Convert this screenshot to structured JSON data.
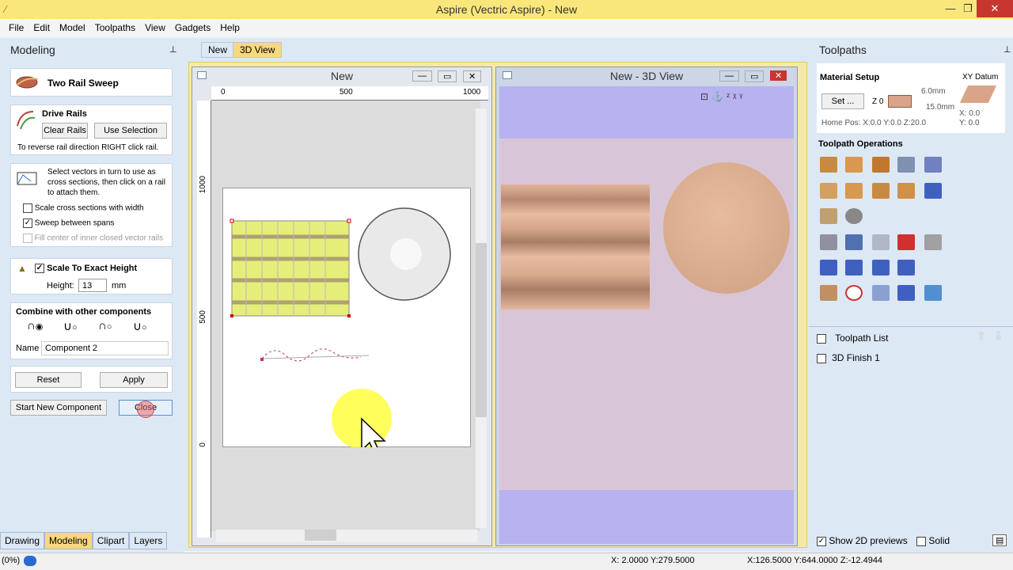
{
  "window": {
    "title": "Aspire (Vectric Aspire) - New",
    "min": "—",
    "max": "❐",
    "close": "✕"
  },
  "menu": [
    "File",
    "Edit",
    "Model",
    "Toolpaths",
    "View",
    "Gadgets",
    "Help"
  ],
  "left": {
    "title": "Modeling",
    "pin": "⊥",
    "tool_title": "Two Rail Sweep",
    "drive_rails": "Drive Rails",
    "clear_rails": "Clear Rails",
    "use_selection": "Use Selection",
    "reverse_hint": "To reverse rail direction RIGHT click rail.",
    "select_hint": "Select vectors in turn to use as cross sections, then click on a rail to attach them.",
    "opt1": "Scale cross sections with width",
    "opt2": "Sweep between spans",
    "opt3": "Fill center of inner closed vector rails",
    "scale_label": "Scale To Exact Height",
    "height_label": "Height:",
    "height_value": "13",
    "height_unit": "mm",
    "combine_title": "Combine with other components",
    "name_label": "Name",
    "name_value": "Component 2",
    "reset": "Reset",
    "apply": "Apply",
    "start_new": "Start New Component",
    "close": "Close"
  },
  "bottom_tabs": [
    "Drawing",
    "Modeling",
    "Clipart",
    "Layers"
  ],
  "doc_tabs": [
    "New",
    "3D View"
  ],
  "view2d": {
    "title": "New",
    "ruler_h": [
      "0",
      "500",
      "1000"
    ],
    "ruler_v": [
      "1000",
      "500",
      "0"
    ]
  },
  "view3d": {
    "title": "New - 3D View"
  },
  "right": {
    "title": "Toolpaths",
    "material_setup": "Material Setup",
    "set_btn": "Set ...",
    "z0": "Z 0",
    "dim1": "6.0mm",
    "dim2": "15.0mm",
    "xy_datum": "XY Datum",
    "x0": "X: 0.0",
    "y0": "Y: 0.0",
    "home_pos": "Home Pos:  X:0.0 Y:0.0 Z:20.0",
    "ops_title": "Toolpath Operations",
    "list_title": "Toolpath List",
    "item1": "3D Finish 1",
    "show2d": "Show 2D previews",
    "solid": "Solid"
  },
  "status": {
    "progress": "(0%)",
    "coords1": "X: 2.0000 Y:279.5000",
    "coords2": "X:126.5000 Y:644.0000 Z:-12.4944"
  },
  "colors": {
    "accent": "#f9e77b",
    "panel": "#dde8f5",
    "wood": "#d9a487"
  }
}
